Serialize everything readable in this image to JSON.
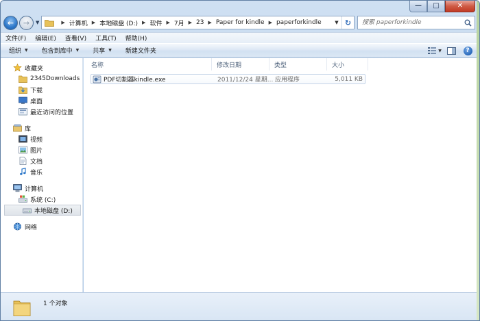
{
  "colors": {
    "accent": "#2c77c9",
    "folder": "#e8c25a",
    "close_button": "#c23a24"
  },
  "window": {
    "minimize_glyph": "—",
    "maximize_glyph": "□",
    "close_glyph": "✕"
  },
  "navigation": {
    "back_icon": "back-arrow-icon",
    "forward_icon": "forward-arrow-icon",
    "breadcrumb": [
      "计算机",
      "本地磁盘 (D:)",
      "软件",
      "7月",
      "23",
      "Paper for kindle",
      "paperforkindle"
    ],
    "search_placeholder": "搜索 paperforkindle"
  },
  "menu": {
    "items": [
      "文件(F)",
      "编辑(E)",
      "查看(V)",
      "工具(T)",
      "帮助(H)"
    ]
  },
  "commands": {
    "items": [
      {
        "label": "组织",
        "dropdown": true
      },
      {
        "label": "包含到库中",
        "dropdown": true
      },
      {
        "label": "共享",
        "dropdown": true
      },
      {
        "label": "新建文件夹",
        "dropdown": false
      }
    ],
    "right_icons": [
      "view-options-icon",
      "preview-pane-icon",
      "help-icon"
    ]
  },
  "sidebar": {
    "favorites": {
      "label": "收藏夹",
      "items": [
        "2345Downloads",
        "下载",
        "桌面",
        "最近访问的位置"
      ]
    },
    "libraries": {
      "label": "库",
      "items": [
        "视频",
        "图片",
        "文档",
        "音乐"
      ]
    },
    "computer": {
      "label": "计算机",
      "items": [
        "系统 (C:)",
        "本地磁盘 (D:)"
      ],
      "selected": "本地磁盘 (D:)"
    },
    "network": {
      "label": "网络"
    }
  },
  "file_list": {
    "columns": [
      "名称",
      "修改日期",
      "类型",
      "大小"
    ],
    "rows": [
      {
        "name": "PDF切割器kindle.exe",
        "modified": "2011/12/24 星期...",
        "type": "应用程序",
        "size": "5,011 KB"
      }
    ]
  },
  "details": {
    "status": "1 个对象"
  }
}
